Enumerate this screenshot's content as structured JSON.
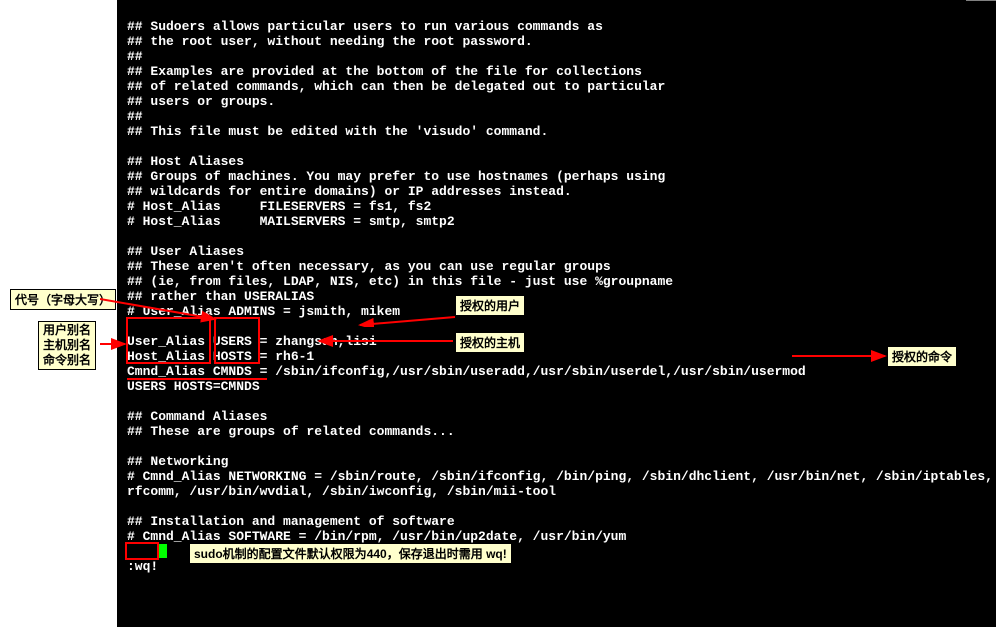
{
  "terminal": {
    "lines": [
      "## Sudoers allows particular users to run various commands as",
      "## the root user, without needing the root password.",
      "##",
      "## Examples are provided at the bottom of the file for collections",
      "## of related commands, which can then be delegated out to particular",
      "## users or groups.",
      "##",
      "## This file must be edited with the 'visudo' command.",
      "",
      "## Host Aliases",
      "## Groups of machines. You may prefer to use hostnames (perhaps using",
      "## wildcards for entire domains) or IP addresses instead.",
      "# Host_Alias     FILESERVERS = fs1, fs2",
      "# Host_Alias     MAILSERVERS = smtp, smtp2",
      "",
      "## User Aliases",
      "## These aren't often necessary, as you can use regular groups",
      "## (ie, from files, LDAP, NIS, etc) in this file - just use %groupname",
      "## rather than USERALIAS",
      "# User_Alias ADMINS = jsmith, mikem",
      "",
      "User_Alias USERS = zhangsan,lisi",
      "Host_Alias HOSTS = rh6-1",
      "Cmnd_Alias CMNDS = /sbin/ifconfig,/usr/sbin/useradd,/usr/sbin/userdel,/usr/sbin/usermod",
      "USERS HOSTS=CMNDS",
      "",
      "## Command Aliases",
      "## These are groups of related commands...",
      "",
      "## Networking",
      "# Cmnd_Alias NETWORKING = /sbin/route, /sbin/ifconfig, /bin/ping, /sbin/dhclient, /usr/bin/net, /sbin/iptables,",
      "rfcomm, /usr/bin/wvdial, /sbin/iwconfig, /sbin/mii-tool",
      "",
      "## Installation and management of software",
      "# Cmnd_Alias SOFTWARE = /bin/rpm, /usr/bin/up2date, /usr/bin/yum",
      "",
      ":wq!"
    ]
  },
  "annotations": {
    "code_upper": "代号（字母大写）",
    "alias_labels": "用户别名\n主机别名\n命令别名",
    "auth_user": "授权的用户",
    "auth_host": "授权的主机",
    "auth_cmd": "授权的命令",
    "wq_tip_prefix": "sudo",
    "wq_tip_mid": "机制的配置文件默认权限为",
    "wq_tip_code": "440",
    "wq_tip_mid2": "，保存退出时需用 ",
    "wq_tip_cmd": "wq!"
  }
}
